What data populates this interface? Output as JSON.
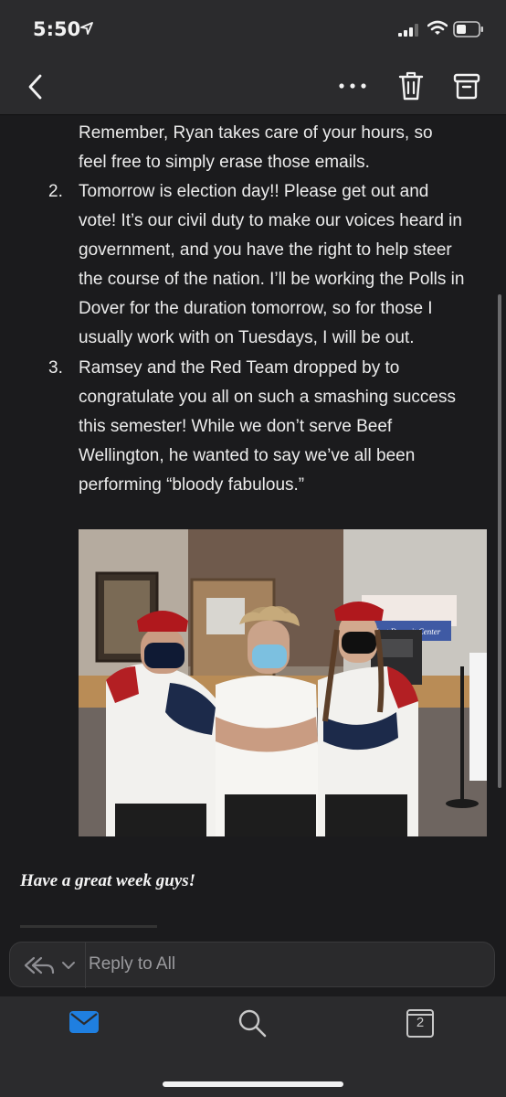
{
  "status": {
    "time": "5:50"
  },
  "nav": {
    "back_icon": "chevron-left-icon",
    "more_icon": "ellipsis-icon",
    "trash_icon": "trash-icon",
    "archive_icon": "archive-icon"
  },
  "email": {
    "clipped_line": "Remember, Ryan takes care of your hours, so",
    "item1_tail": [
      "Remember, Ryan takes care of your hours, so",
      "feel free to simply erase those emails."
    ],
    "items": [
      {
        "number": "2.",
        "lines": [
          " Tomorrow is election day!! Please get out and",
          "vote! It’s our civil duty to make our voices heard in",
          "government, and you have the right to help steer",
          "the course of the nation. I’ll be working the Polls in",
          "Dover for the duration tomorrow, so for those I",
          "usually work with on Tuesdays, I will be out."
        ]
      },
      {
        "number": "3.",
        "lines": [
          " Ramsey and the Red Team dropped by to",
          "congratulate you all on such a smashing success",
          "this semester! While we don’t serve Beef",
          "Wellington, he wanted to say we’ve all been",
          "performing “bloody fabulous.”"
        ]
      }
    ],
    "photo_sign_text": "Wildcat Deposit Center",
    "closing": "Have a great week guys!"
  },
  "reply": {
    "placeholder": "Reply to All"
  },
  "tabs": {
    "calendar_day": "2"
  },
  "colors": {
    "accent": "#1f7fe0",
    "background": "#1b1b1d",
    "bar": "#2b2b2d"
  }
}
